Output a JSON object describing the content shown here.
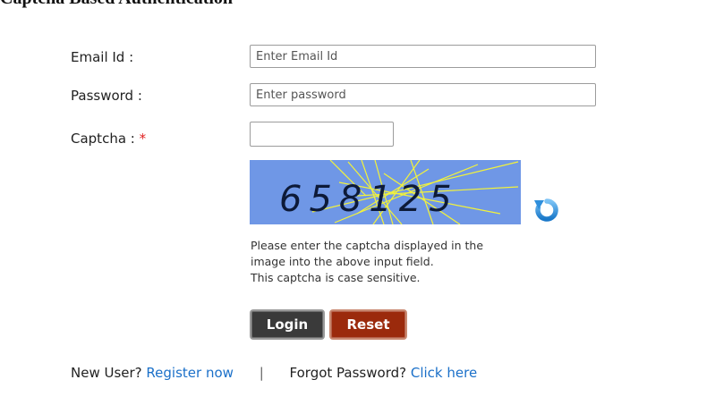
{
  "header": {
    "fragment": "Captcha Based Authentication"
  },
  "form": {
    "email_label": "Email Id :",
    "email_placeholder": "Enter Email Id",
    "email_value": "",
    "password_label": "Password :",
    "password_placeholder": "Enter password",
    "password_value": "",
    "captcha_label": "Captcha :",
    "captcha_required_mark": "*",
    "captcha_value": "",
    "captcha_text": "658125",
    "help_lines": [
      "Please enter the captcha displayed in the",
      "image into the above input field.",
      "This captcha is case sensitive."
    ]
  },
  "buttons": {
    "login": "Login",
    "reset": "Reset"
  },
  "footer": {
    "new_user_text": "New User?",
    "register_link": "Register now",
    "separator": "|",
    "forgot_text": "Forgot Password?",
    "click_here_link": "Click here"
  },
  "colors": {
    "captcha_bg": "#6f97e6",
    "link": "#1b70c9",
    "login_btn": "#3a3a3a",
    "reset_btn": "#9b2a0c",
    "required": "#e02020"
  }
}
